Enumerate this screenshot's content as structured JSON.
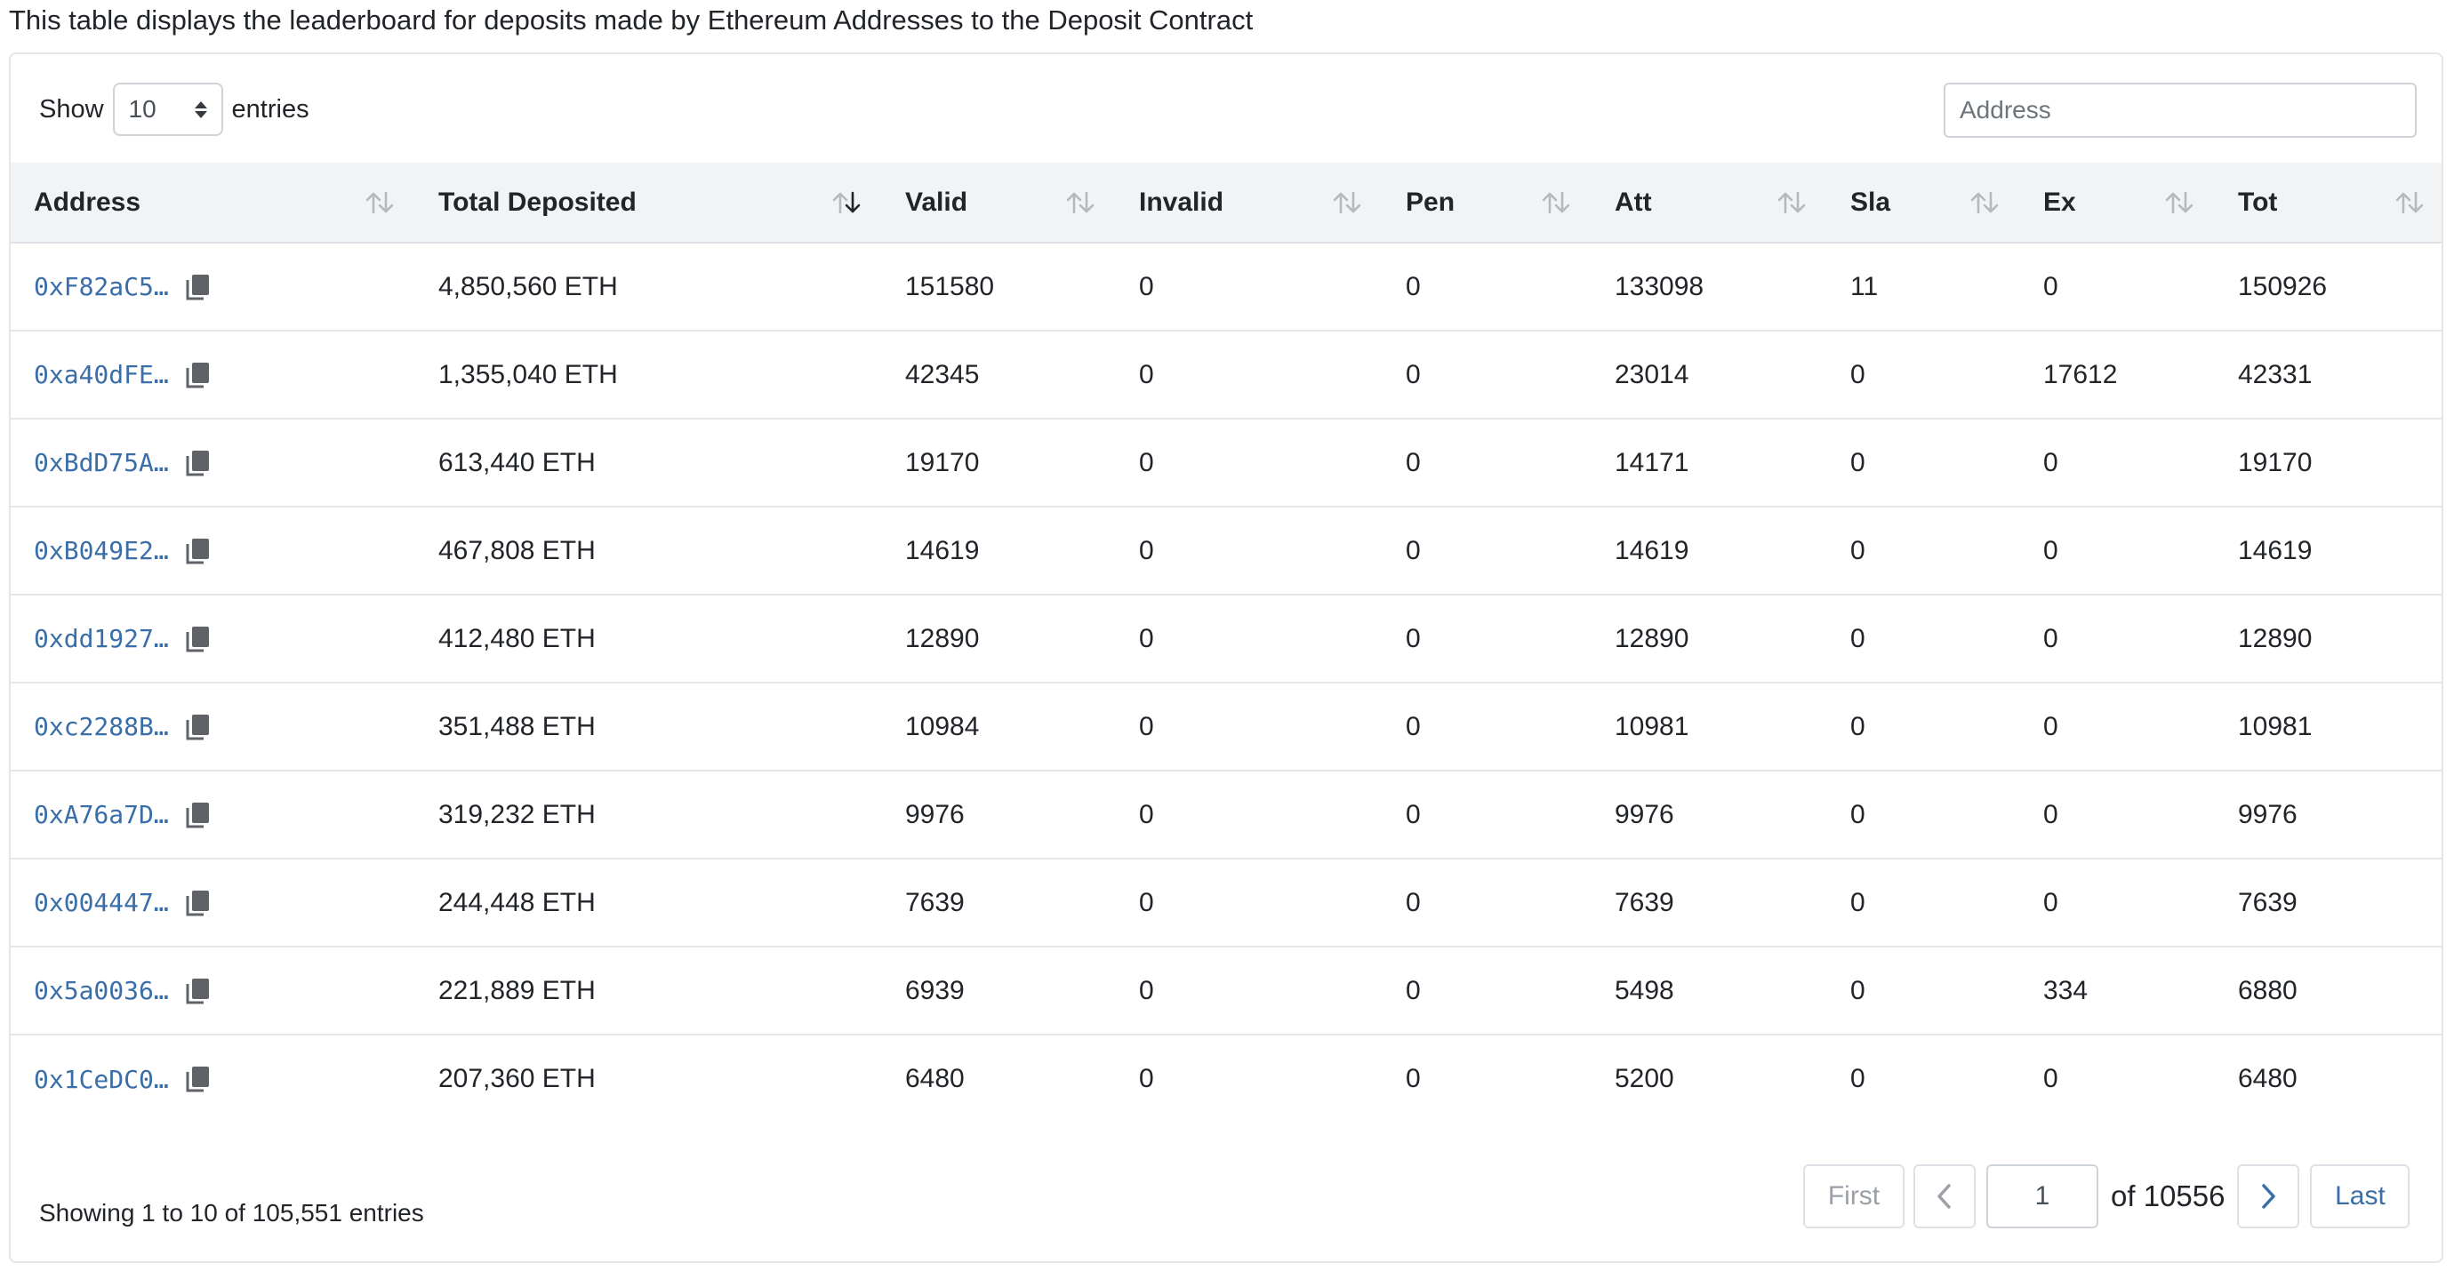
{
  "intro_text": "This table displays the leaderboard for deposits made by Ethereum Addresses to the Deposit Contract",
  "length_control": {
    "show_label": "Show",
    "value": "10",
    "entries_label": "entries"
  },
  "search": {
    "placeholder": "Address"
  },
  "columns": [
    "Address",
    "Total Deposited",
    "Valid",
    "Invalid",
    "Pen",
    "Att",
    "Sla",
    "Ex",
    "Tot"
  ],
  "active_sort": {
    "column": "Total Deposited",
    "direction": "descending"
  },
  "rows": [
    {
      "address": "0xF82aC5…",
      "total": "4,850,560 ETH",
      "valid": "151580",
      "invalid": "0",
      "pen": "0",
      "att": "133098",
      "sla": "11",
      "ex": "0",
      "tot": "150926"
    },
    {
      "address": "0xa40dFE…",
      "total": "1,355,040 ETH",
      "valid": "42345",
      "invalid": "0",
      "pen": "0",
      "att": "23014",
      "sla": "0",
      "ex": "17612",
      "tot": "42331"
    },
    {
      "address": "0xBdD75A…",
      "total": "613,440 ETH",
      "valid": "19170",
      "invalid": "0",
      "pen": "0",
      "att": "14171",
      "sla": "0",
      "ex": "0",
      "tot": "19170"
    },
    {
      "address": "0xB049E2…",
      "total": "467,808 ETH",
      "valid": "14619",
      "invalid": "0",
      "pen": "0",
      "att": "14619",
      "sla": "0",
      "ex": "0",
      "tot": "14619"
    },
    {
      "address": "0xdd1927…",
      "total": "412,480 ETH",
      "valid": "12890",
      "invalid": "0",
      "pen": "0",
      "att": "12890",
      "sla": "0",
      "ex": "0",
      "tot": "12890"
    },
    {
      "address": "0xc2288B…",
      "total": "351,488 ETH",
      "valid": "10984",
      "invalid": "0",
      "pen": "0",
      "att": "10981",
      "sla": "0",
      "ex": "0",
      "tot": "10981"
    },
    {
      "address": "0xA76a7D…",
      "total": "319,232 ETH",
      "valid": "9976",
      "invalid": "0",
      "pen": "0",
      "att": "9976",
      "sla": "0",
      "ex": "0",
      "tot": "9976"
    },
    {
      "address": "0x004447…",
      "total": "244,448 ETH",
      "valid": "7639",
      "invalid": "0",
      "pen": "0",
      "att": "7639",
      "sla": "0",
      "ex": "0",
      "tot": "7639"
    },
    {
      "address": "0x5a0036…",
      "total": "221,889 ETH",
      "valid": "6939",
      "invalid": "0",
      "pen": "0",
      "att": "5498",
      "sla": "0",
      "ex": "334",
      "tot": "6880"
    },
    {
      "address": "0x1CeDC0…",
      "total": "207,360 ETH",
      "valid": "6480",
      "invalid": "0",
      "pen": "0",
      "att": "5200",
      "sla": "0",
      "ex": "0",
      "tot": "6480"
    }
  ],
  "footer": {
    "info": "Showing 1 to 10 of 105,551 entries",
    "pagination": {
      "first_label": "First",
      "current_page": "1",
      "of_text": "of 10556",
      "last_label": "Last"
    }
  },
  "colors": {
    "link": "#3a6ea8",
    "header_bg": "#f2f3f4",
    "border": "#dee2e6",
    "sort_icon_inactive": "#b5b9bd",
    "sort_icon_active": "#212529"
  },
  "icons": {
    "copy": "copy-icon",
    "sort": "sort-arrows-icon",
    "select": "select-updown-icon",
    "prev": "chevron-left-icon",
    "next": "chevron-right-icon"
  }
}
